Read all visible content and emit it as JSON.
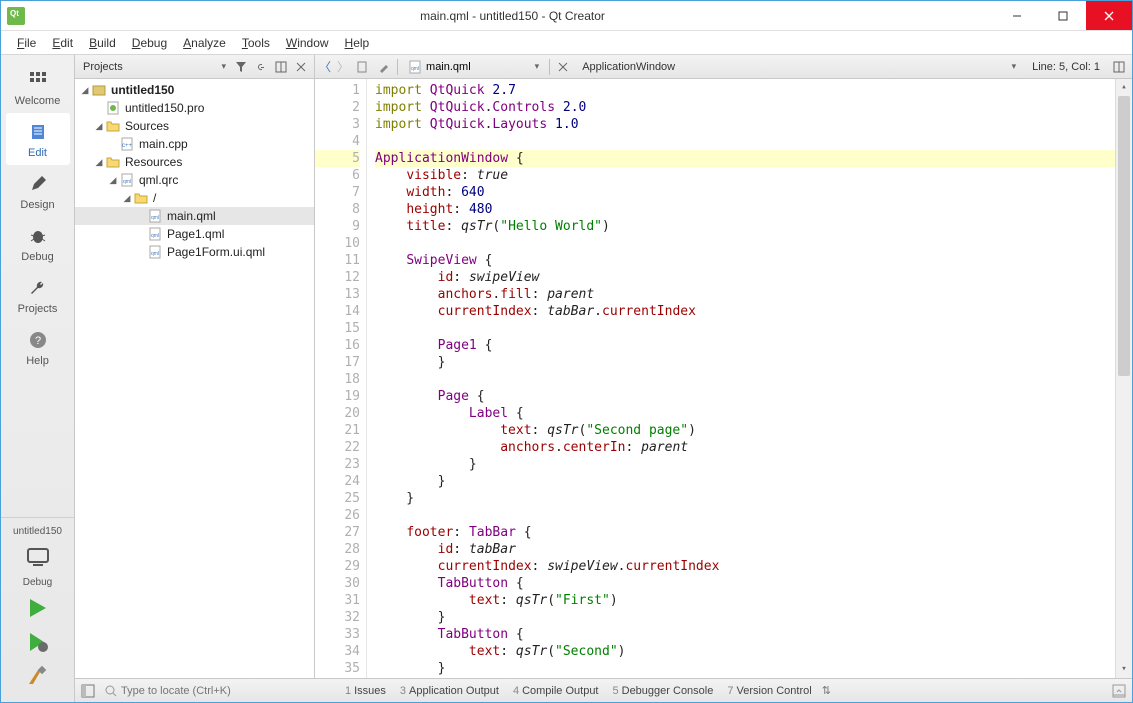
{
  "window": {
    "title": "main.qml - untitled150 - Qt Creator"
  },
  "menu": {
    "items": [
      "File",
      "Edit",
      "Build",
      "Debug",
      "Analyze",
      "Tools",
      "Window",
      "Help"
    ]
  },
  "modes": {
    "welcome": "Welcome",
    "edit": "Edit",
    "design": "Design",
    "debug": "Debug",
    "projects": "Projects",
    "help": "Help"
  },
  "target": {
    "project": "untitled150",
    "kit": "Debug"
  },
  "sidebar": {
    "selector": "Projects",
    "tree": {
      "root": "untitled150",
      "pro": "untitled150.pro",
      "sources": "Sources",
      "maincpp": "main.cpp",
      "resources": "Resources",
      "qrc": "qml.qrc",
      "slash": "/",
      "mainqml": "main.qml",
      "page1qml": "Page1.qml",
      "page1form": "Page1Form.ui.qml"
    }
  },
  "editor": {
    "file": "main.qml",
    "symbol": "ApplicationWindow",
    "linecol": "Line: 5, Col: 1",
    "code": [
      {
        "n": 1,
        "raw": "import QtQuick 2.7"
      },
      {
        "n": 2,
        "raw": "import QtQuick.Controls 2.0"
      },
      {
        "n": 3,
        "raw": "import QtQuick.Layouts 1.0"
      },
      {
        "n": 4,
        "raw": ""
      },
      {
        "n": 5,
        "raw": "ApplicationWindow {"
      },
      {
        "n": 6,
        "raw": "    visible: true"
      },
      {
        "n": 7,
        "raw": "    width: 640"
      },
      {
        "n": 8,
        "raw": "    height: 480"
      },
      {
        "n": 9,
        "raw": "    title: qsTr(\"Hello World\")"
      },
      {
        "n": 10,
        "raw": ""
      },
      {
        "n": 11,
        "raw": "    SwipeView {"
      },
      {
        "n": 12,
        "raw": "        id: swipeView"
      },
      {
        "n": 13,
        "raw": "        anchors.fill: parent"
      },
      {
        "n": 14,
        "raw": "        currentIndex: tabBar.currentIndex"
      },
      {
        "n": 15,
        "raw": ""
      },
      {
        "n": 16,
        "raw": "        Page1 {"
      },
      {
        "n": 17,
        "raw": "        }"
      },
      {
        "n": 18,
        "raw": ""
      },
      {
        "n": 19,
        "raw": "        Page {"
      },
      {
        "n": 20,
        "raw": "            Label {"
      },
      {
        "n": 21,
        "raw": "                text: qsTr(\"Second page\")"
      },
      {
        "n": 22,
        "raw": "                anchors.centerIn: parent"
      },
      {
        "n": 23,
        "raw": "            }"
      },
      {
        "n": 24,
        "raw": "        }"
      },
      {
        "n": 25,
        "raw": "    }"
      },
      {
        "n": 26,
        "raw": ""
      },
      {
        "n": 27,
        "raw": "    footer: TabBar {"
      },
      {
        "n": 28,
        "raw": "        id: tabBar"
      },
      {
        "n": 29,
        "raw": "        currentIndex: swipeView.currentIndex"
      },
      {
        "n": 30,
        "raw": "        TabButton {"
      },
      {
        "n": 31,
        "raw": "            text: qsTr(\"First\")"
      },
      {
        "n": 32,
        "raw": "        }"
      },
      {
        "n": 33,
        "raw": "        TabButton {"
      },
      {
        "n": 34,
        "raw": "            text: qsTr(\"Second\")"
      },
      {
        "n": 35,
        "raw": "        }"
      }
    ]
  },
  "bottom": {
    "locator_placeholder": "Type to locate (Ctrl+K)",
    "panes": [
      {
        "n": "1",
        "label": "Issues"
      },
      {
        "n": "3",
        "label": "Application Output"
      },
      {
        "n": "4",
        "label": "Compile Output"
      },
      {
        "n": "5",
        "label": "Debugger Console"
      },
      {
        "n": "7",
        "label": "Version Control"
      }
    ]
  }
}
